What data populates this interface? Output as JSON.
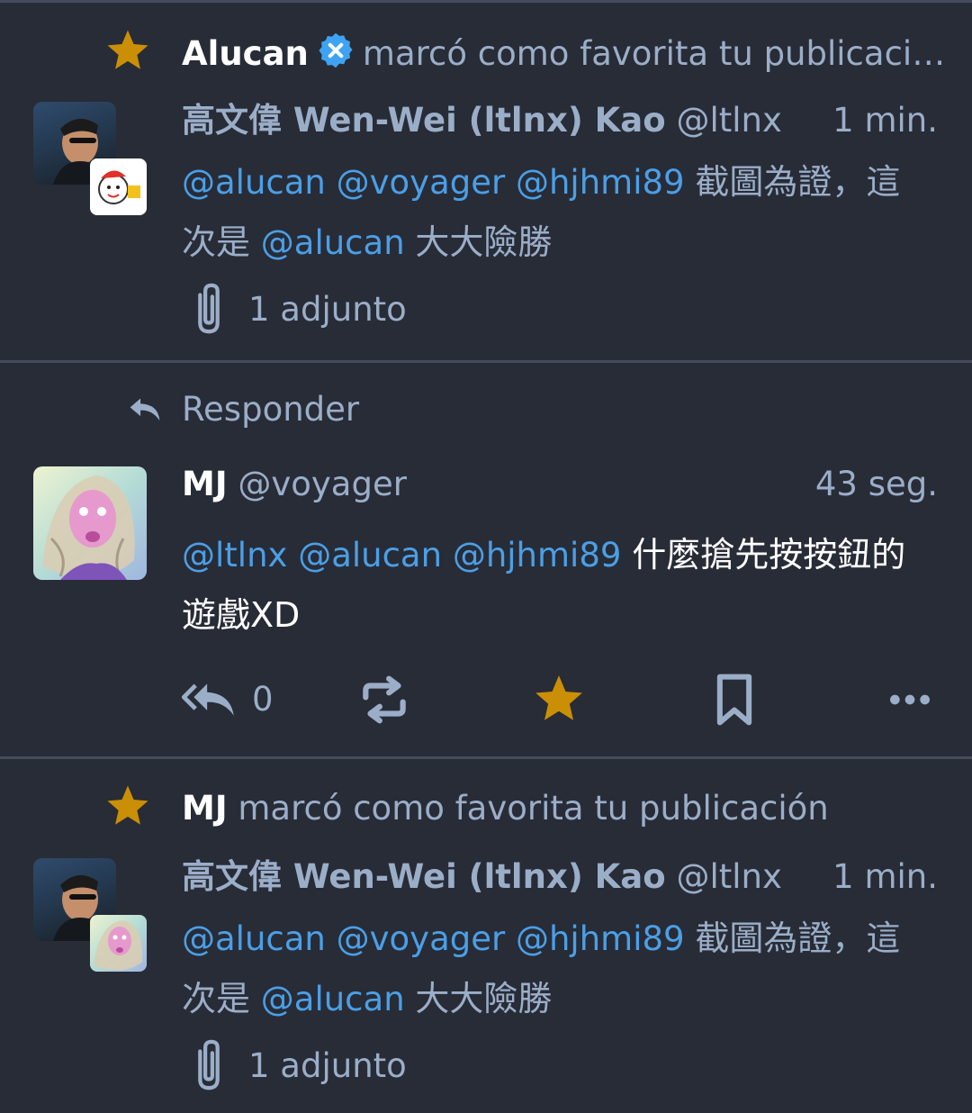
{
  "colors": {
    "background": "#282c37",
    "divider": "#444b5d",
    "mention": "#4b9fe6",
    "muted": "#9baec8",
    "favourite": "#ca8f04",
    "text": "#ffffff"
  },
  "notifications": [
    {
      "type": "favourite",
      "icon": "star-icon",
      "actor": "Alucan",
      "actor_verified": true,
      "action": "marcó como favorita tu publicaci…",
      "status": {
        "author_name": "高文偉 Wen-Wei (ltlnx) Kao",
        "author_handle": "@ltlnx",
        "time": "1 min.",
        "mentions": [
          "@alucan",
          "@voyager",
          "@hjhmi89"
        ],
        "text_part1": "截圖為證，這",
        "text_part2_prefix": "次是",
        "text_part2_mention": "@alucan",
        "text_part2_suffix": "大大險勝",
        "attachment_label": "1 adjunto"
      }
    },
    {
      "type": "reply",
      "icon": "reply-icon",
      "label": "Responder",
      "status": {
        "author_name": "MJ",
        "author_handle": "@voyager",
        "time": "43 seg.",
        "mentions": [
          "@ltlnx",
          "@alucan",
          "@hjhmi89"
        ],
        "text_part1": "什麼搶先按按鈕的",
        "text_part2": "遊戲XD"
      },
      "actions": {
        "reply_count": "0",
        "reply_icon": "reply-all-icon",
        "boost_icon": "retweet-icon",
        "favourite_icon": "star-icon",
        "bookmark_icon": "bookmark-icon",
        "more_icon": "ellipsis-icon"
      }
    },
    {
      "type": "favourite",
      "icon": "star-icon",
      "actor": "MJ",
      "action": "marcó como favorita tu publicación",
      "status": {
        "author_name": "高文偉 Wen-Wei (ltlnx) Kao",
        "author_handle": "@ltlnx",
        "time": "1 min.",
        "mentions": [
          "@alucan",
          "@voyager",
          "@hjhmi89"
        ],
        "text_part1": "截圖為證，這",
        "text_part2_prefix": "次是",
        "text_part2_mention": "@alucan",
        "text_part2_suffix": "大大險勝",
        "attachment_label": "1 adjunto"
      }
    }
  ]
}
